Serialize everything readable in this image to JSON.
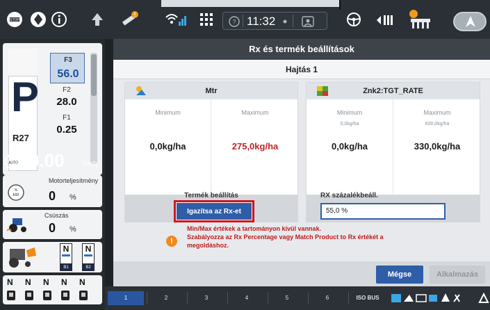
{
  "topbar": {
    "clock": "11:32",
    "icons": [
      "stop-icon",
      "steer-indicator-icon",
      "info-icon",
      "up-arrow-icon",
      "satellite-icon",
      "signal-icon",
      "grid-icon",
      "help-icon",
      "user-icon",
      "steering-wheel-icon",
      "implement-icon",
      "planter-icon",
      "auto-steer-icon"
    ],
    "auto_label": "AUTO"
  },
  "left_panel": {
    "gear": "P",
    "reverse": "R27",
    "f3_label": "F3",
    "f3_value": "56.0",
    "f2_label": "F2",
    "f2_value": "28.0",
    "f1_label": "F1",
    "f1_value": "0.25",
    "speed_value": "0.00",
    "speed_unit": "km/h",
    "engine_title": "Motorteljesítmény",
    "engine_value": "0",
    "engine_unit": "%",
    "slip_title": "Csúszás",
    "slip_value": "0",
    "slip_unit": "%",
    "hitch": [
      {
        "n": "N",
        "label": "B1"
      },
      {
        "n": "N",
        "label": "B2"
      }
    ],
    "n_row": [
      "N",
      "N",
      "N",
      "N",
      "N"
    ]
  },
  "dialog": {
    "title": "Rx és termék beállítások",
    "subtitle": "Hajtás 1",
    "left_panel": {
      "header": "Mtr",
      "min_label": "Minimum",
      "max_label": "Maximum",
      "min_value": "0,0kg/ha",
      "max_value": "275,0kg/ha",
      "footer_label": "Termék beállítás",
      "button_label": "Igazítsa az Rx-et"
    },
    "right_panel": {
      "header": "Znk2:TGT_RATE",
      "min_label": "Minimum",
      "max_label": "Maximum",
      "min_unit": "0,0kg/ha",
      "max_unit": "600,0kg/ha",
      "min_value": "0,0kg/ha",
      "max_value": "330,0kg/ha",
      "footer_label": "RX százalékbeáll.",
      "input_value": "55,0  %"
    },
    "warning_line1": "Min/Max értékek a tartományon kívül vannak.",
    "warning_line2": "Szabályozza az Rx Percentage vagy Match Product to Rx értékét a",
    "warning_line3": "megoldáshoz.",
    "cancel_label": "Mégse",
    "apply_label": "Alkalmazás"
  },
  "bottombar": {
    "tabs": [
      "1",
      "2",
      "3",
      "4",
      "5",
      "6"
    ],
    "isobus": "ISO BUS"
  },
  "colors": {
    "accent_blue": "#2f5ea8",
    "warning_red": "#c21a1a",
    "warning_orange": "#f08a18",
    "max_value_red": "#c0252b",
    "highlight_border": "#d3141c"
  }
}
